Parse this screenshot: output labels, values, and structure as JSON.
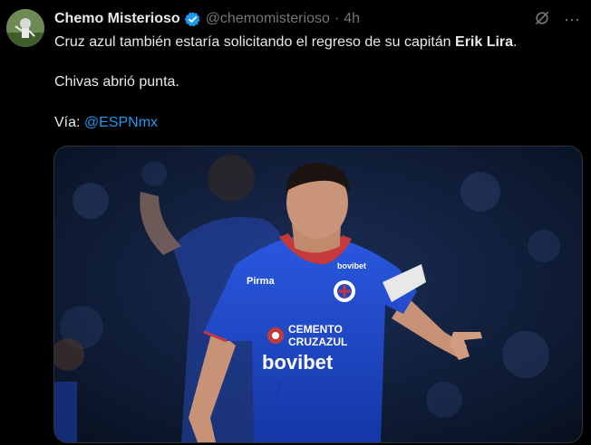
{
  "tweet": {
    "author_name": "Chemo Misterioso",
    "handle": "@chemomisterioso",
    "separator": "·",
    "time": "4h",
    "text_line1_prefix": "Cruz azul también estaría solicitando el regreso de su capitán ",
    "text_line1_bold": "Erik Lira",
    "text_line1_suffix": ".",
    "text_line2": "Chivas abrió punta.",
    "via_label": "Vía: ",
    "via_mention": "@ESPNmx",
    "more_icon": "⋯"
  },
  "media": {
    "jersey_sponsor_line1": "CEMENTO",
    "jersey_sponsor_line2": "CRUZAZUL",
    "jersey_sponsor_main": "bovibet",
    "jersey_sleeve_brand": "bovibet",
    "jersey_chest_brand": "Pirma",
    "jersey_color": "#1b46c9",
    "background_color": "#0e1a34"
  },
  "colors": {
    "accent_link": "#1d9bf0",
    "muted": "#71767b",
    "text": "#e7e9ea",
    "background": "#000000"
  }
}
